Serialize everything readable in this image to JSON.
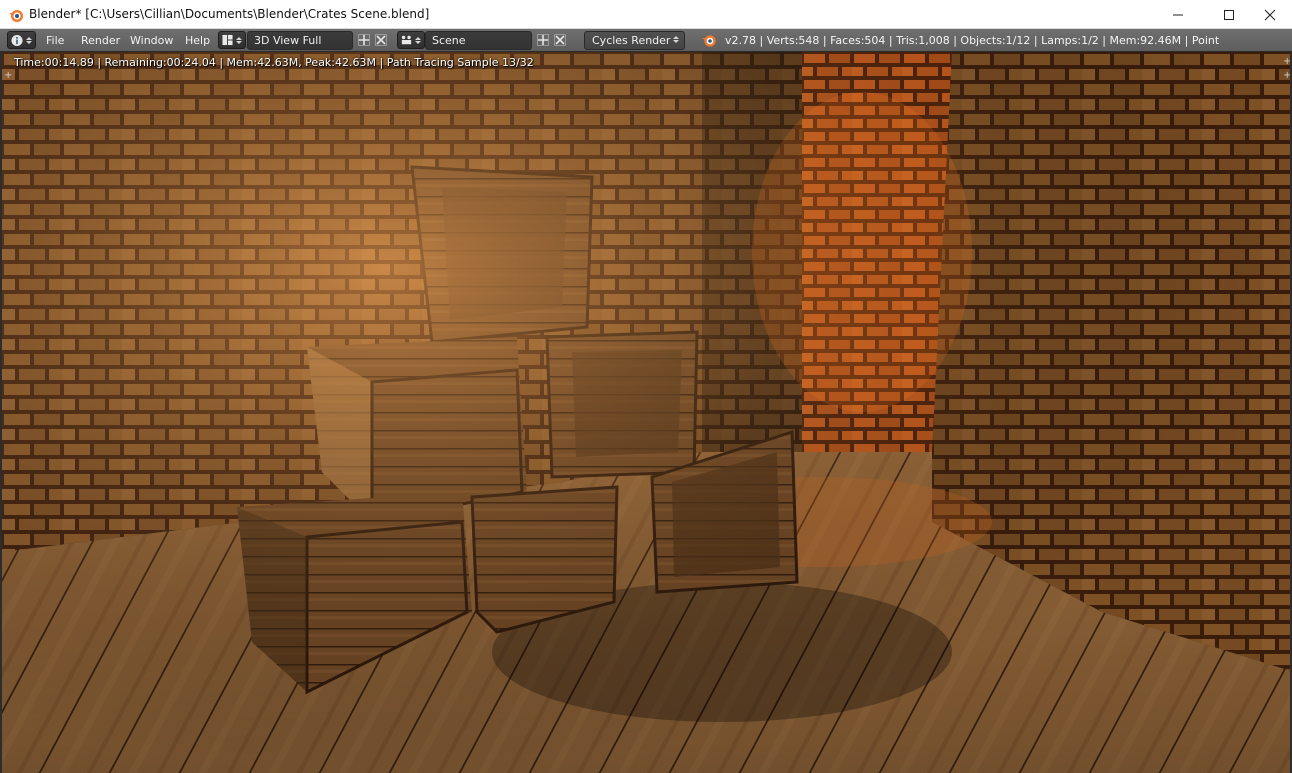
{
  "window": {
    "title": "Blender* [C:\\Users\\Cillian\\Documents\\Blender\\Crates Scene.blend]",
    "controls": [
      "minimize",
      "maximize",
      "close"
    ]
  },
  "header": {
    "editor_type_icon": "info-icon",
    "menus": [
      "File",
      "Render",
      "Window",
      "Help"
    ],
    "screen_layout": {
      "icon": "layout-grid-icon",
      "value": "3D View Full"
    },
    "scene": {
      "icon": "scene-icon",
      "value": "Scene"
    },
    "render_engine": "Cycles Render",
    "stats_icon": "blender-logo-icon",
    "stats": "v2.78 | Verts:548 | Faces:504 | Tris:1,008 | Objects:1/12 | Lamps:1/2 | Mem:92.46M | Point"
  },
  "viewport": {
    "render_status": "Time:00:14.89 | Remaining:00:24.04 | Mem:42.63M, Peak:42.63M | Path Tracing Sample 13/32"
  },
  "colors": {
    "header_bg": "#666666",
    "brick": "#8a5a2a",
    "mortar": "#3a1c0c",
    "wood_floor": "#b07a45",
    "crate": "#6b4524",
    "lamp_glow": "#e06a1e"
  }
}
